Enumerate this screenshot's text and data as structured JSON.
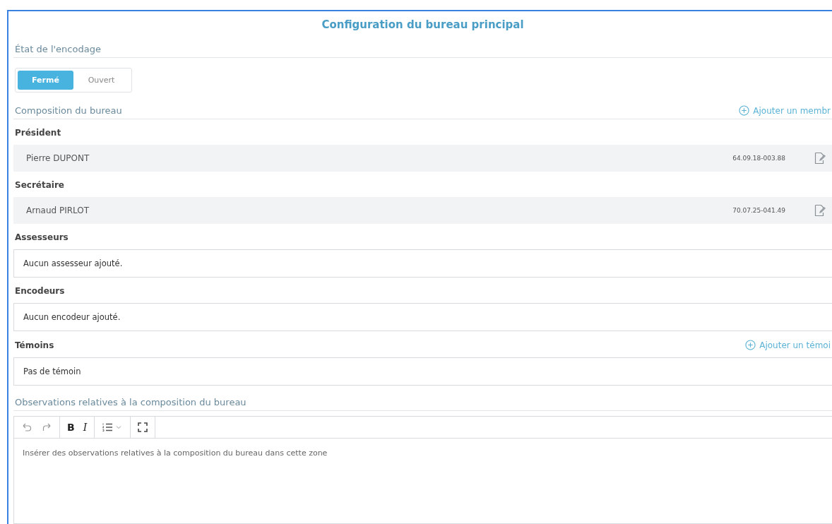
{
  "title": "Configuration du bureau principal",
  "encoding": {
    "heading": "État de l'encodage",
    "options": [
      {
        "label": "Fermé",
        "selected": true
      },
      {
        "label": "Ouvert",
        "selected": false
      }
    ]
  },
  "composition": {
    "heading": "Composition du bureau",
    "add_link": "Ajouter un membr",
    "members": [
      {
        "role": "Président",
        "name": "Pierre DUPONT",
        "number": "64.09.18-003.88"
      },
      {
        "role": "Secrétaire",
        "name": "Arnaud PIRLOT",
        "number": "70.07.25-041.49"
      }
    ],
    "groups": [
      {
        "role": "Assesseurs",
        "empty_text": "Aucun assesseur ajouté."
      },
      {
        "role": "Encodeurs",
        "empty_text": "Aucun encodeur ajouté."
      },
      {
        "role": "Témoins",
        "empty_text": "Pas de témoin",
        "add_link": "Ajouter un témoi"
      }
    ]
  },
  "observations": {
    "heading": "Observations relatives à la composition du bureau",
    "toolbar": [
      {
        "kind": "undo"
      },
      {
        "kind": "redo"
      },
      {
        "kind": "bold",
        "label": "B"
      },
      {
        "kind": "italic",
        "label": "I"
      },
      {
        "kind": "list"
      },
      {
        "kind": "fullscreen"
      }
    ],
    "placeholder": "Insérer des observations relatives à la composition du bureau dans cette zone"
  }
}
